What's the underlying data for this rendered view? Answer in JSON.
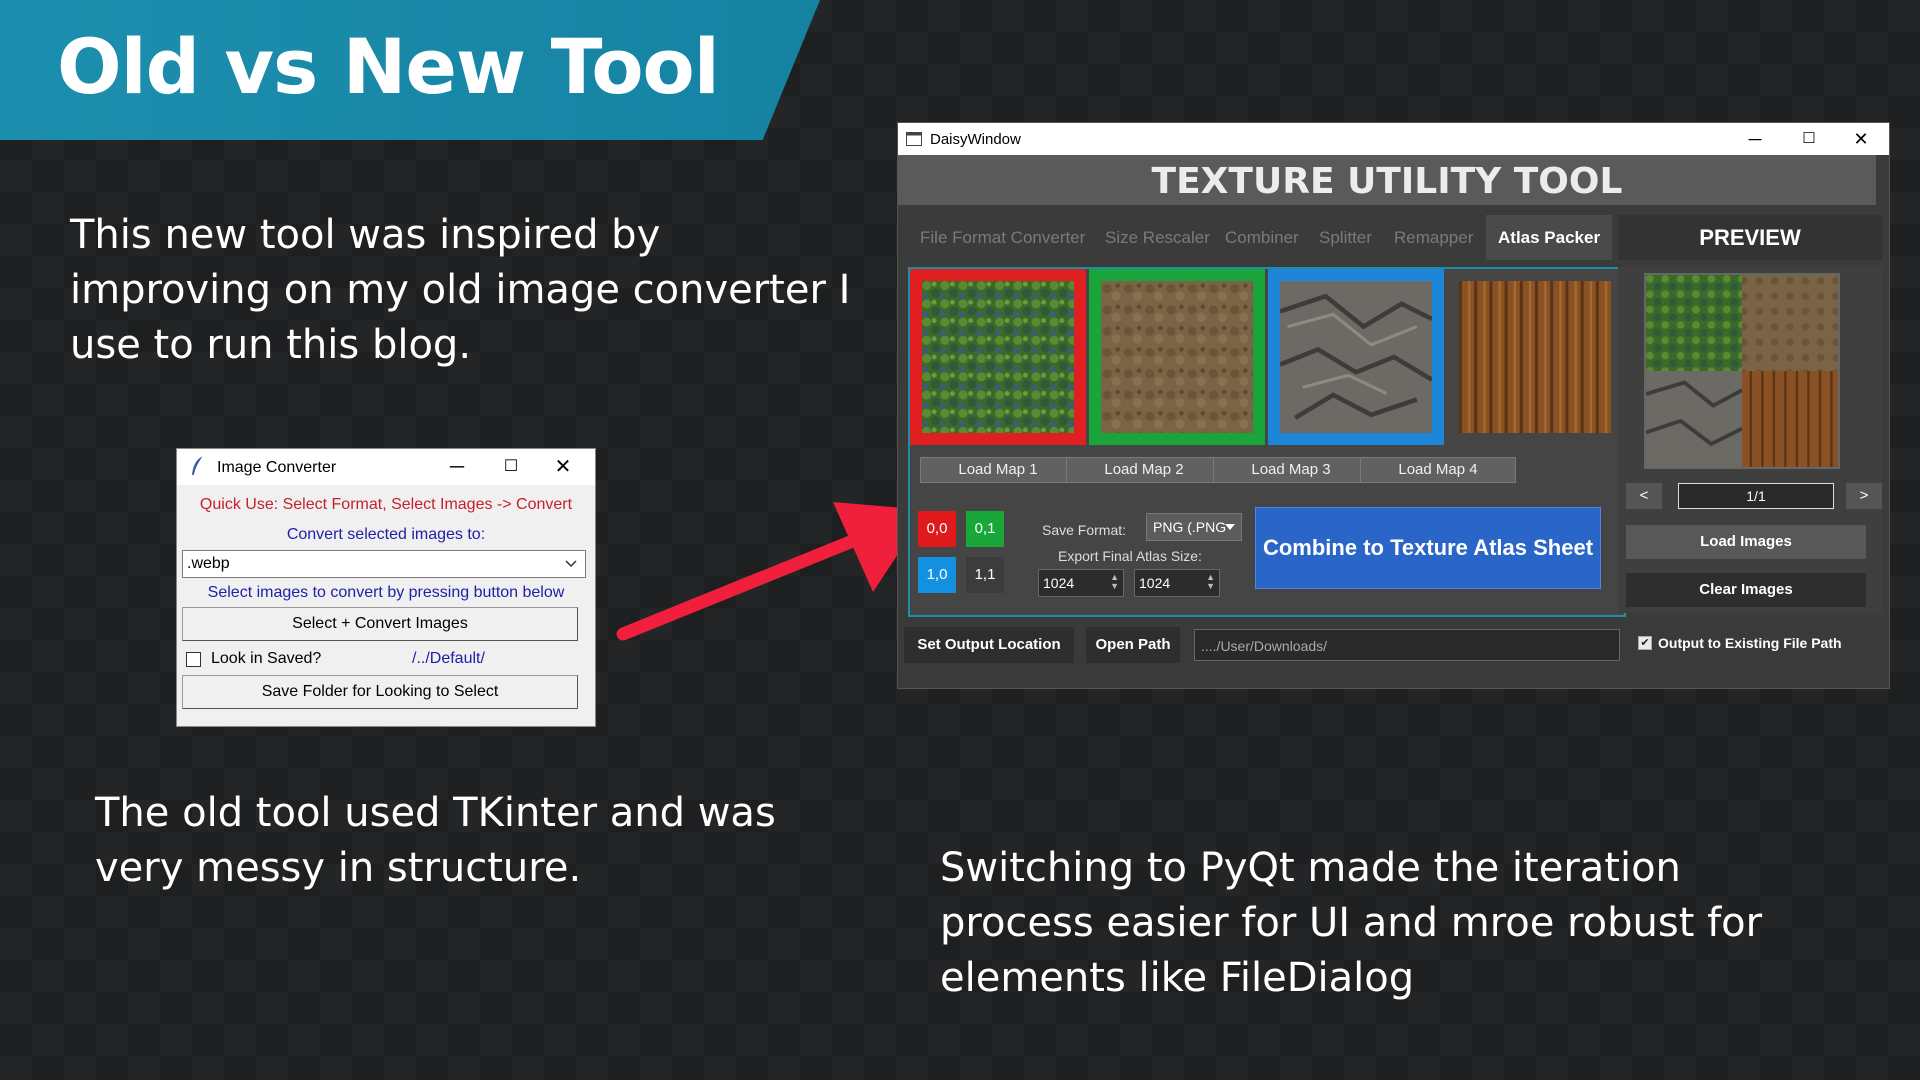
{
  "slide": {
    "title": "Old vs New Tool",
    "intro": "This new tool was inspired by improving on my old image converter I use to run this blog.",
    "old_note": "The old tool used TKinter and was very messy in structure.",
    "new_note": "Switching to PyQt made the iteration process easier for UI and mroe robust for elements like FileDialog"
  },
  "old_window": {
    "title": "Image Converter",
    "quick_use": "Quick Use: Select Format, Select Images -> Convert",
    "convert_label": "Convert selected images to:",
    "format_value": ".webp",
    "hint": "Select images to convert by pressing button below",
    "select_button": "Select + Convert Images",
    "look_in_saved": "Look in Saved?",
    "default_path": "/../Default/",
    "save_folder_button": "Save Folder for Looking to Select"
  },
  "new_window": {
    "title": "DaisyWindow",
    "header": "TEXTURE UTILITY TOOL",
    "tabs": [
      {
        "label": "File Format Converter",
        "active": false
      },
      {
        "label": "Size Rescaler",
        "active": false
      },
      {
        "label": "Combiner",
        "active": false
      },
      {
        "label": "Splitter",
        "active": false
      },
      {
        "label": "Remapper",
        "active": false
      },
      {
        "label": "Atlas Packer",
        "active": true
      }
    ],
    "preview_label": "PREVIEW",
    "load_maps": [
      "Load Map 1",
      "Load Map 2",
      "Load Map 3",
      "Load Map 4"
    ],
    "quadrants": [
      "0,0",
      "0,1",
      "1,0",
      "1,1"
    ],
    "save_format_label": "Save Format:",
    "save_format_value": "PNG (.PNG",
    "atlas_size_label": "Export Final Atlas Size:",
    "atlas_width": "1024",
    "atlas_height": "1024",
    "combine_button": "Combine to Texture Atlas Sheet",
    "prev": "<",
    "page": "1/1",
    "next": ">",
    "load_images": "Load Images",
    "clear_images": "Clear Images",
    "set_output": "Set Output Location",
    "open_path": "Open Path",
    "output_path": "..../User/Downloads/",
    "existing_label": "Output to Existing File Path",
    "existing_checked": true
  },
  "colors": {
    "banner": "#1d8fae",
    "quadrant_00": "#e01a1a",
    "quadrant_01": "#18a83a",
    "quadrant_10": "#1390e0",
    "combine": "#2a66c8",
    "arrow": "#f0203c"
  },
  "icons": [
    "feather-icon",
    "minimize-icon",
    "maximize-icon",
    "close-icon",
    "dropdown-arrow-icon",
    "app-window-icon",
    "arrow-pointer"
  ]
}
